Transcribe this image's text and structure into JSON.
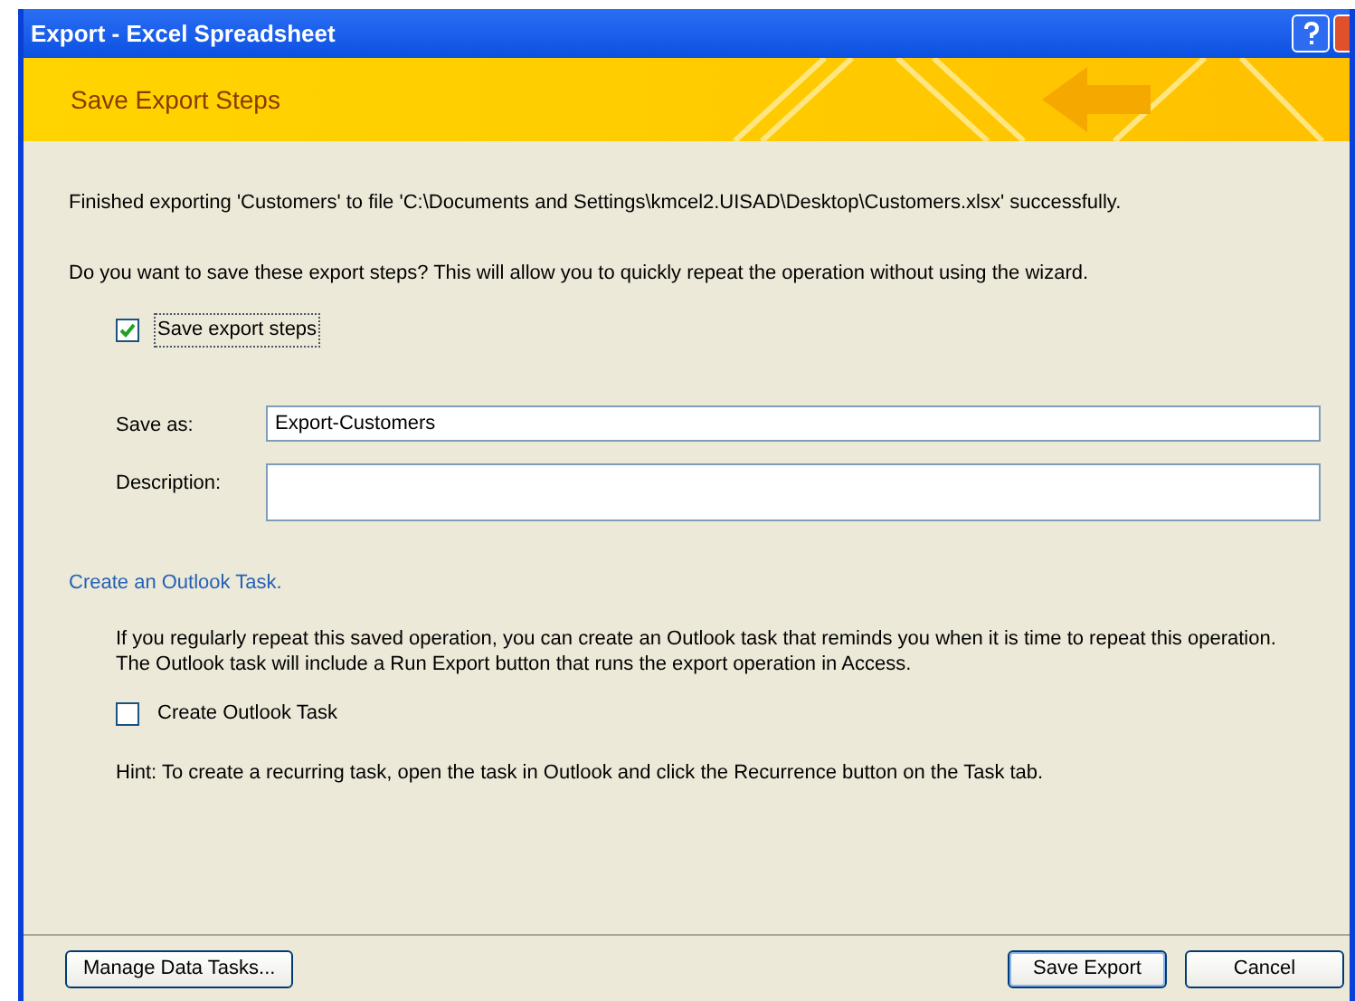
{
  "window": {
    "title": "Export - Excel Spreadsheet"
  },
  "banner": {
    "title": "Save Export Steps"
  },
  "message": "Finished exporting 'Customers' to file 'C:\\Documents and Settings\\kmcel2.UISAD\\Desktop\\Customers.xlsx' successfully.",
  "question": "Do you want to save these export steps? This will allow you to quickly repeat the operation without using the wizard.",
  "save_steps": {
    "label": "Save export steps",
    "checked": true
  },
  "fields": [
    {
      "label": "Save as:",
      "value": "Export-Customers",
      "kind": "single"
    },
    {
      "label": "Description:",
      "kind": "multi"
    }
  ],
  "outlook": {
    "heading": "Create an Outlook Task.",
    "text": "If you regularly repeat this saved operation, you can create an Outlook task that reminds you when it is time to repeat this operation. The Outlook task will include a Run Export button that runs the export operation in Access.",
    "checkbox": {
      "label": "Create Outlook Task",
      "checked": false
    },
    "hint": "Hint: To create a recurring task, open the task in Outlook and click the Recurrence button on the Task tab."
  },
  "footer": {
    "left_button": "Manage Data Tasks...",
    "buttons": [
      "Save Export",
      "Cancel"
    ]
  }
}
